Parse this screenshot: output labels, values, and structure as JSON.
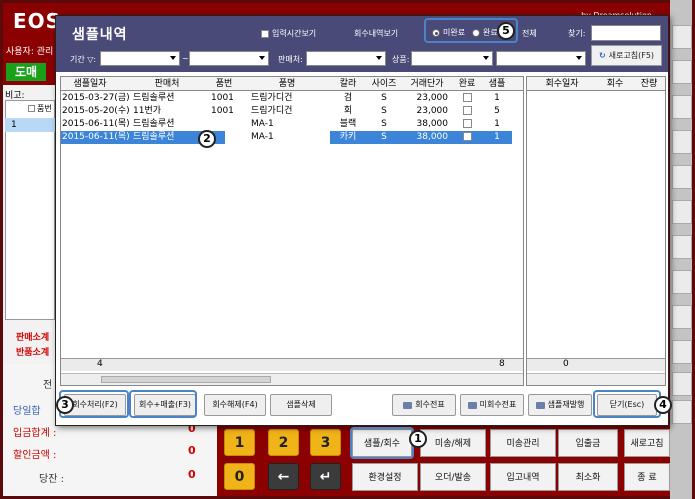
{
  "app": {
    "logo": "EOS",
    "brand": "by Dreamsolution",
    "user_label": "사용자: 관리",
    "mode_button": "도매",
    "memo_label": "비고:",
    "row_number": "1",
    "product_label": "품번",
    "sales_total_label": "판매소계",
    "return_total_label": "반품소계",
    "summary": {
      "prev_label": "전",
      "cash_label": "당일합",
      "deposit_label": "입금합계 :",
      "deposit_value": "0",
      "discount_label": "할인금액 :",
      "discount_value": "0",
      "balance_label": "당잔 :",
      "balance_value": "0"
    },
    "keypad": [
      "1",
      "2",
      "3",
      "0",
      "←",
      "↵"
    ],
    "function_buttons": [
      {
        "label": "샘플/회수"
      },
      {
        "label": "미송/해제"
      },
      {
        "label": "미송관리"
      },
      {
        "label": "입출금"
      },
      {
        "label": "새로고침"
      },
      {
        "label": "환경설정"
      },
      {
        "label": "오더/발송"
      },
      {
        "label": "입고내역"
      },
      {
        "label": "최소화"
      },
      {
        "label": "종 료"
      }
    ]
  },
  "modal": {
    "title": "샘플내역",
    "input_time_check": "입력시간보기",
    "collect_history_label": "회수내역보기",
    "radio_incomplete": "미완료",
    "radio_complete": "완료",
    "radio_all": "전체",
    "find_label": "찾기:",
    "period_label": "기간 ▽:",
    "seller_label": "판매처:",
    "product_label": "상품:",
    "refresh_button": "새로고침(F5)",
    "columns": [
      "샘플일자",
      "판매처",
      "품번",
      "품명",
      "칼라",
      "사이즈",
      "거래단가",
      "완료",
      "샘플"
    ],
    "rows": [
      {
        "date": "2015-03-27(금)",
        "seller": "드림솔루션",
        "code": "1001",
        "name": "드림가디건",
        "color": "검",
        "size": "S",
        "price": "23,000",
        "qty": "1"
      },
      {
        "date": "2015-05-20(수)",
        "seller": "11번가",
        "code": "1001",
        "name": "드림가디건",
        "color": "회",
        "size": "S",
        "price": "23,000",
        "qty": "5"
      },
      {
        "date": "2015-06-11(목)",
        "seller": "드림솔루션",
        "code": "",
        "name": "MA-1",
        "color": "블랙",
        "size": "S",
        "price": "38,000",
        "qty": "1"
      },
      {
        "date": "2015-06-11(목)",
        "seller": "드림솔루션",
        "code": "",
        "name": "MA-1",
        "color": "카키",
        "size": "S",
        "price": "38,000",
        "qty": "1"
      }
    ],
    "footer_count": "4",
    "footer_sum": "8",
    "right_columns": [
      "회수일자",
      "회수",
      "잔량"
    ],
    "right_footer": "0",
    "buttons": {
      "collect": "회수처리(F2)",
      "collect_sale": "회수+매출(F3)",
      "collect_cancel": "회수해제(F4)",
      "delete_sample": "샘플삭제",
      "collect_slip": "회수전표",
      "uncollected_slip": "미회수전표",
      "reissue_sample": "샘플재발행",
      "close": "닫기(Esc)"
    }
  },
  "callouts": [
    "1",
    "2",
    "3",
    "4",
    "5"
  ]
}
